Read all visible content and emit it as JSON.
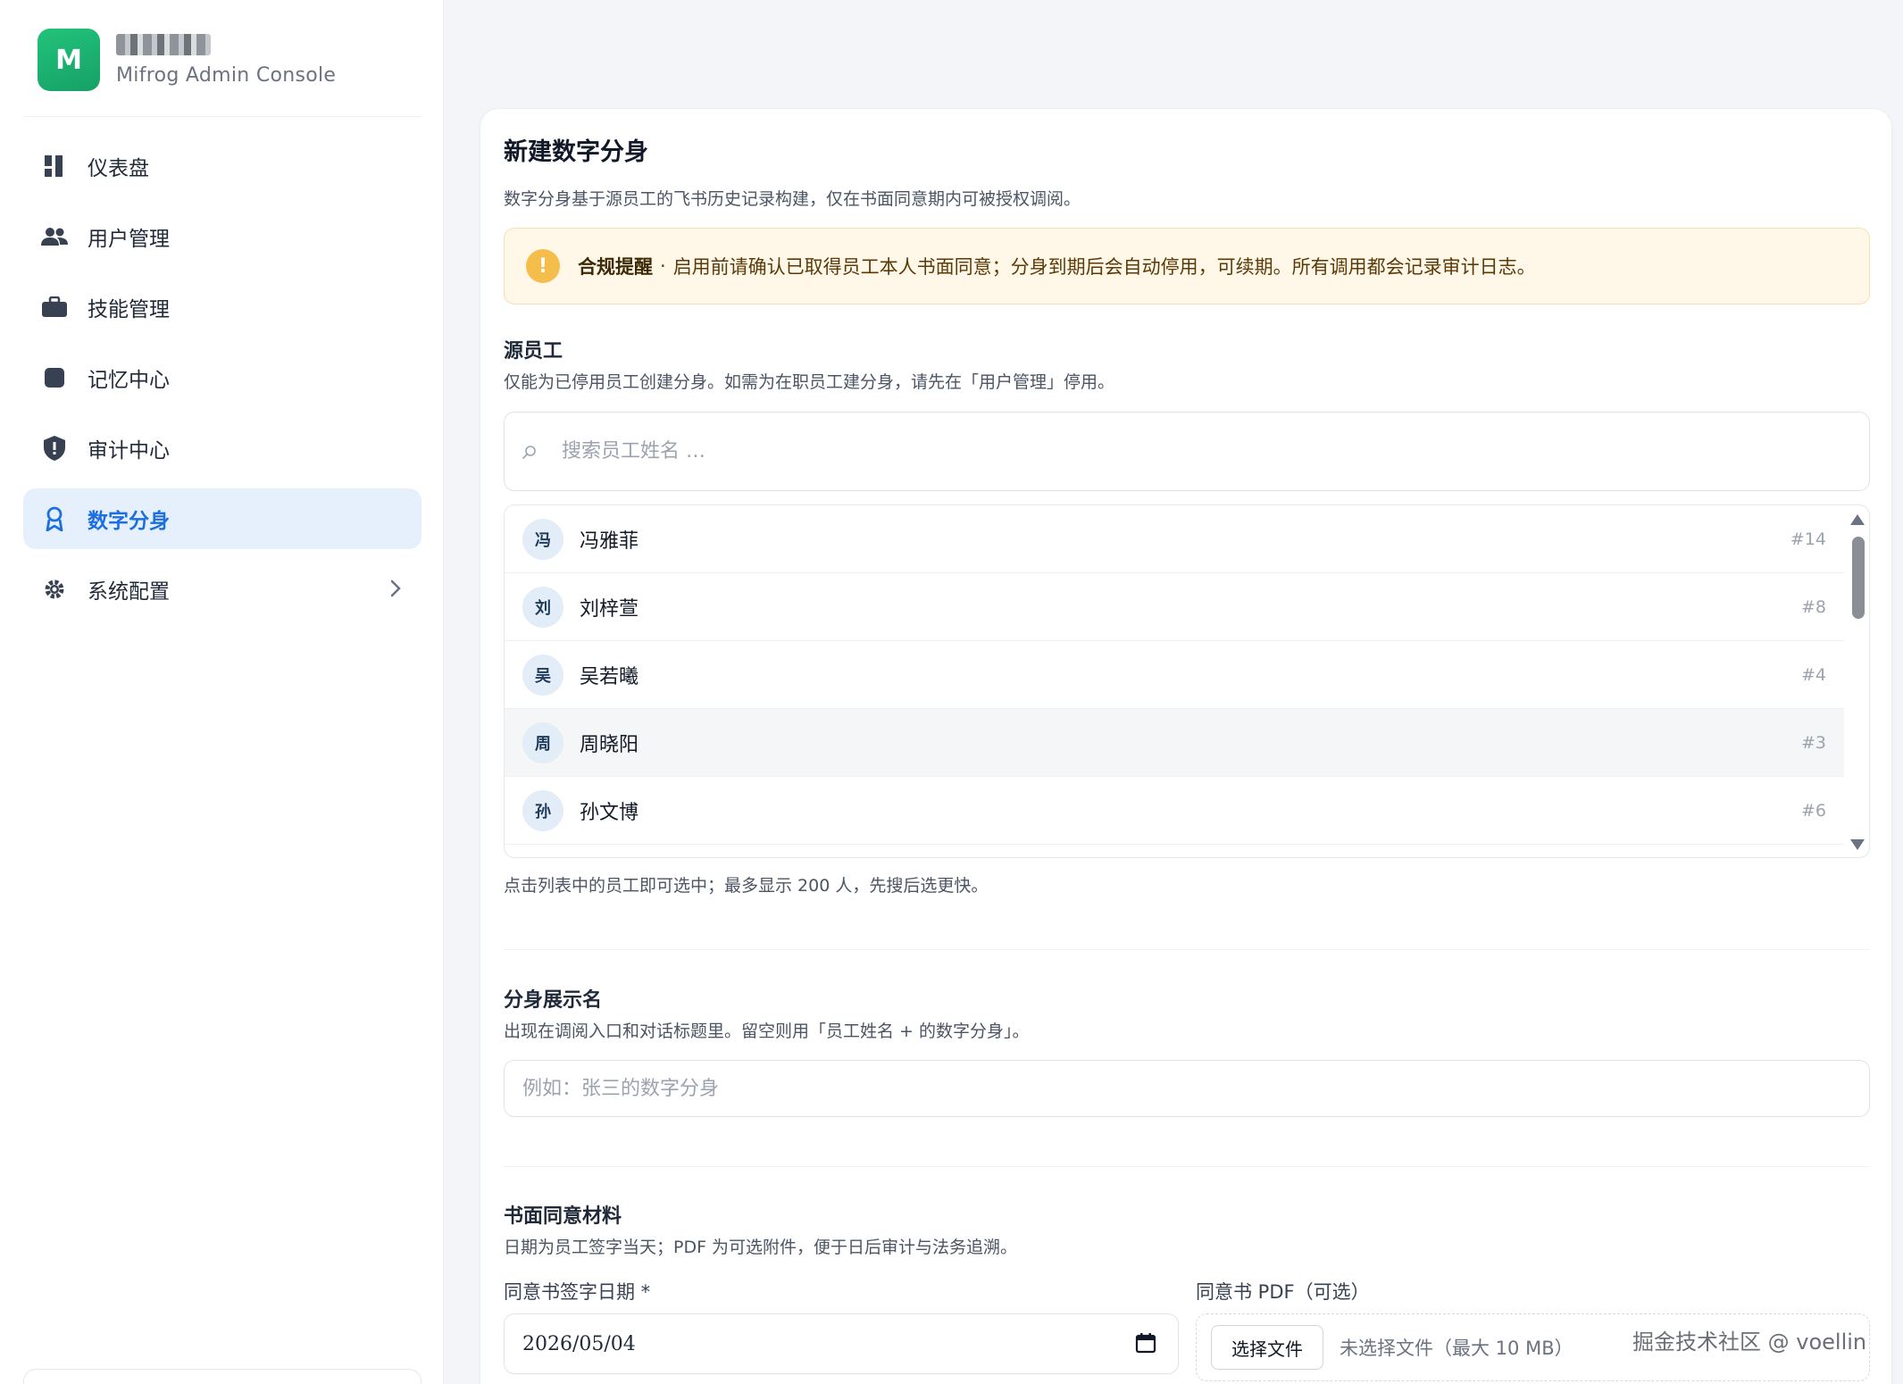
{
  "brand": {
    "logo_letter": "M",
    "subtitle": "Mifrog Admin Console"
  },
  "nav": {
    "items": [
      {
        "label": "仪表盘",
        "icon": "dashboard-icon"
      },
      {
        "label": "用户管理",
        "icon": "users-icon"
      },
      {
        "label": "技能管理",
        "icon": "briefcase-icon"
      },
      {
        "label": "记忆中心",
        "icon": "memory-icon"
      },
      {
        "label": "审计中心",
        "icon": "shield-icon"
      },
      {
        "label": "数字分身",
        "icon": "avatar-badge-icon",
        "active": true
      },
      {
        "label": "系统配置",
        "icon": "gear-icon",
        "has_submenu": true
      }
    ]
  },
  "page": {
    "title": "新建数字分身",
    "description": "数字分身基于源员工的飞书历史记录构建，仅在书面同意期内可被授权调阅。"
  },
  "alert": {
    "icon_char": "!",
    "title": "合规提醒",
    "separator": "·",
    "message": "启用前请确认已取得员工本人书面同意；分身到期后会自动停用，可续期。所有调用都会记录审计日志。"
  },
  "source_employee": {
    "title": "源员工",
    "description": "仅能为已停用员工创建分身。如需为在职员工建分身，请先在「用户管理」停用。",
    "search_placeholder": "搜索员工姓名 …",
    "employees": [
      {
        "initial": "冯",
        "name": "冯雅菲",
        "id": "#14"
      },
      {
        "initial": "刘",
        "name": "刘梓萱",
        "id": "#8"
      },
      {
        "initial": "吴",
        "name": "吴若曦",
        "id": "#4"
      },
      {
        "initial": "周",
        "name": "周晓阳",
        "id": "#3",
        "hovered": true
      },
      {
        "initial": "孙",
        "name": "孙文博",
        "id": "#6"
      }
    ],
    "hint": "点击列表中的员工即可选中；最多显示 200 人，先搜后选更快。"
  },
  "display_name": {
    "title": "分身展示名",
    "description": "出现在调阅入口和对话标题里。留空则用「员工姓名 + 的数字分身」。",
    "placeholder": "例如：张三的数字分身"
  },
  "consent": {
    "title": "书面同意材料",
    "description": "日期为员工签字当天；PDF 为可选附件，便于日后审计与法务追溯。",
    "date_label": "同意书签字日期 *",
    "date_value": "2026/05/04",
    "pdf_label": "同意书 PDF（可选）",
    "file_button": "选择文件",
    "file_status": "未选择文件（最大 10 MB）"
  },
  "watermark": "掘金技术社区 @ voellin",
  "colors": {
    "accent": "#1d6fe0",
    "active_bg": "#e6f0fd",
    "brand_green": "#16a067",
    "alert_bg": "#fff7e8",
    "alert_icon": "#f5be4a"
  }
}
